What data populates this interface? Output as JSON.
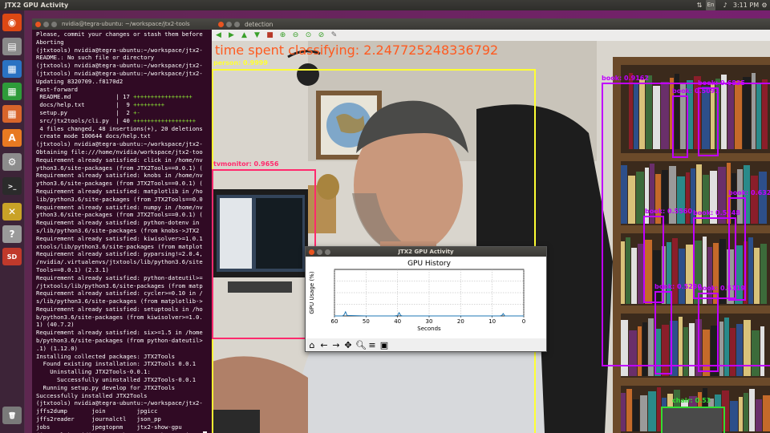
{
  "topbar": {
    "title": "JTX2 GPU Activity",
    "keyboard": "En",
    "clock": "3:11 PM"
  },
  "launcher": {
    "items": [
      {
        "name": "ubuntu-dash-icon",
        "color": "#dd4814",
        "glyph": "◉"
      },
      {
        "name": "files-icon",
        "color": "#8a8a8a",
        "glyph": "▤"
      },
      {
        "name": "writer-icon",
        "color": "#2a72c3",
        "glyph": "▦"
      },
      {
        "name": "calc-icon",
        "color": "#2e9b3a",
        "glyph": "▦"
      },
      {
        "name": "impress-icon",
        "color": "#d8652b",
        "glyph": "▦"
      },
      {
        "name": "software-center-icon",
        "color": "#e87a22",
        "glyph": "A"
      },
      {
        "name": "system-settings-icon",
        "color": "#8c8c8c",
        "glyph": "⚙"
      },
      {
        "name": "terminal-icon",
        "color": "#2b2b2b",
        "glyph": ">_"
      },
      {
        "name": "tools-icon",
        "color": "#c9a227",
        "glyph": "✕"
      },
      {
        "name": "help-icon",
        "color": "#9a9a9a",
        "glyph": "?"
      },
      {
        "name": "sd-card-icon",
        "color": "#c0392b",
        "glyph": "SD"
      },
      {
        "name": "trash-icon",
        "color": "#7a7a7a",
        "glyph": "🗑"
      }
    ]
  },
  "terminal": {
    "title": "nvidia@tegra-ubuntu: ~/workspace/jtx2-tools",
    "lines": [
      "Please, commit your changes or stash them before",
      "Aborting",
      "(jtxtools) nvidia@tegra-ubuntu:~/workspace/jtx2-",
      "README.: No such file or directory",
      "(jtxtools) nvidia@tegra-ubuntu:~/workspace/jtx2-",
      "(jtxtools) nvidia@tegra-ubuntu:~/workspace/jtx2-",
      "Updating 8320709..f8170d2",
      "Fast-forward",
      " README.md             | 17 +++++++++++++++++",
      " docs/help.txt         |  9 +++++++++",
      " setup.py              |  2 +-",
      " src/jtx2tools/cli.py  | 40 ++++++++++++++++++",
      " 4 files changed, 48 insertions(+), 20 deletions",
      " create mode 100644 docs/help.txt",
      "(jtxtools) nvidia@tegra-ubuntu:~/workspace/jtx2-",
      "Obtaining file:///home/nvidia/workspace/jtx2-too",
      "Requirement already satisfied: click in /home/nv",
      "ython3.6/site-packages (from JTX2Tools==0.0.1) (",
      "Requirement already satisfied: knobs in /home/nv",
      "ython3.6/site-packages (from JTX2Tools==0.0.1) (",
      "Requirement already satisfied: matplotlib in /ho",
      "lib/python3.6/site-packages (from JTX2Tools==0.0",
      "Requirement already satisfied: numpy in /home/nv",
      "ython3.6/site-packages (from JTX2Tools==0.0.1) (",
      "Requirement already satisfied: python-dotenv in",
      "s/lib/python3.6/site-packages (from knobs->JTX2",
      "Requirement already satisfied: kiwisolver>=1.0.1",
      "xtools/lib/python3.6/site-packages (from matplot",
      "Requirement already satisfied: pyparsing!=2.0.4,",
      "/nvidia/.virtualenvs/jtxtools/lib/python3.6/site",
      "Tools==0.0.1) (2.3.1)",
      "Requirement already satisfied: python-dateutil>=",
      "/jtxtools/lib/python3.6/site-packages (from matp",
      "Requirement already satisfied: cycler>=0.10 in /",
      "s/lib/python3.6/site-packages (from matplotlib->",
      "Requirement already satisfied: setuptools in /ho",
      "b/python3.6/site-packages (from kiwisolver>=1.0.",
      "1) (40.7.2)",
      "Requirement already satisfied: six>=1.5 in /home",
      "b/python3.6/site-packages (from python-dateutil>",
      ".1) (1.12.0)",
      "Installing collected packages: JTX2Tools",
      "  Found existing installation: JTX2Tools 0.0.1",
      "    Uninstalling JTX2Tools-0.0.1:",
      "      Successfully uninstalled JTX2Tools-0.0.1",
      "  Running setup.py develop for JTX2Tools",
      "Successfully installed JTX2Tools",
      "(jtxtools) nvidia@tegra-ubuntu:~/workspace/jtx2-",
      "jffs2dump       join         jpgicc",
      "jffs2reader     journalctl   json_pp",
      "jobs            jpegtopnm    jtx2-show-gpu",
      "(jtxtools) nvidia@tegra-ubuntu:~/workspace/jtx2-"
    ]
  },
  "detection": {
    "title": "detection",
    "time_text": "time spent classifying: 2.247725248336792",
    "time_color": "#ff5a1f",
    "boxes": [
      {
        "label": "person: 0.9999",
        "color": "#ffff33"
      },
      {
        "label": "tvmonitor: 0.9656",
        "color": "#ff2a6d"
      },
      {
        "label": "book: 0.9162",
        "color": "#c000ff"
      },
      {
        "label": "book: 0.6835",
        "color": "#c000ff"
      },
      {
        "label": "book: 0.5091",
        "color": "#c000ff"
      },
      {
        "label": "book: 0.6322",
        "color": "#c000ff"
      },
      {
        "label": "book: 0.5560",
        "color": "#c000ff"
      },
      {
        "label": "book: 0.5248",
        "color": "#c000ff"
      },
      {
        "label": "book: 0.5230",
        "color": "#c000ff"
      },
      {
        "label": "book: 0.5119",
        "color": "#c000ff"
      },
      {
        "label": "chair: 0.53",
        "color": "#33dd33"
      }
    ]
  },
  "gpu_window": {
    "title": "JTX2 GPU Activity",
    "chart_title": "GPU History"
  },
  "chart_data": {
    "type": "line",
    "title": "GPU History",
    "xlabel": "Seconds",
    "ylabel": "GPU Usage (%)",
    "xlim": [
      60,
      0
    ],
    "ylim": [
      0,
      100
    ],
    "xticks": [
      60,
      50,
      40,
      30,
      20,
      10,
      0
    ],
    "grid": true,
    "series": [
      {
        "color": "#1f77b4",
        "x": [
          60,
          58.5,
          57.5,
          57,
          56.5,
          56,
          50,
          45,
          41,
          40,
          39.5,
          39,
          38.5,
          30,
          20,
          10,
          7.5,
          7,
          6.5,
          6,
          0
        ],
        "y": [
          0,
          0,
          0,
          2,
          9,
          1,
          0,
          0,
          0,
          1,
          7,
          1,
          0,
          0,
          0,
          0,
          0,
          1,
          5,
          0,
          0
        ]
      }
    ]
  }
}
